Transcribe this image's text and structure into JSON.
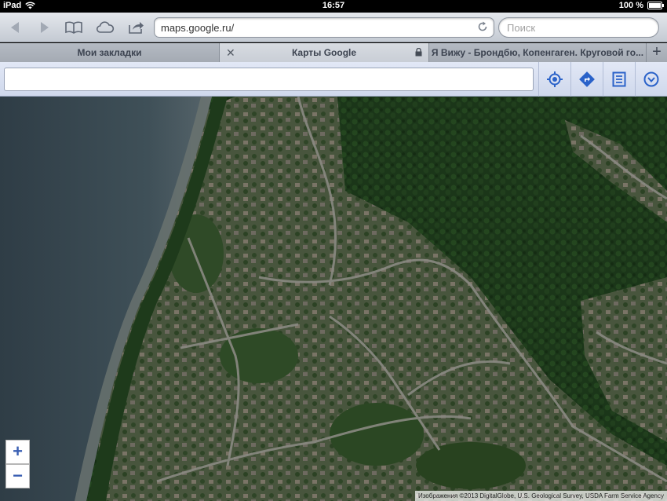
{
  "status": {
    "device": "iPad",
    "time": "16:57",
    "battery": "100 %"
  },
  "browser": {
    "url": "maps.google.ru/",
    "search_placeholder": "Поиск",
    "tabs": [
      {
        "label": "Мои закладки",
        "state": "inactive"
      },
      {
        "label": "Карты Google",
        "state": "active"
      },
      {
        "label": "Я Вижу - Брондбю, Копенгаген. Круговой го...",
        "state": "inactive"
      }
    ],
    "new_tab": "+",
    "icons": [
      "back-icon",
      "forward-icon",
      "bookmarks-icon",
      "icloud-icon",
      "share-icon",
      "reload-icon",
      "lock-icon",
      "close-icon",
      "plus-icon"
    ]
  },
  "maps": {
    "search_value": "",
    "buttons": [
      "locate-icon",
      "directions-icon",
      "list-icon",
      "menu-icon"
    ],
    "zoom_in": "+",
    "zoom_out": "−",
    "attribution": "Изображения ©2013 DigitalGlobe, U.S. Geological Survey, USDA Farm Service Agency"
  },
  "colors": {
    "water": "#3b4a52",
    "forest": "#1c3a1a",
    "neighborhood": "#47543c",
    "road": "#8c8c84",
    "gmaps_accent": "#2a62c9",
    "toolbar_bg": "#d5dae1"
  }
}
